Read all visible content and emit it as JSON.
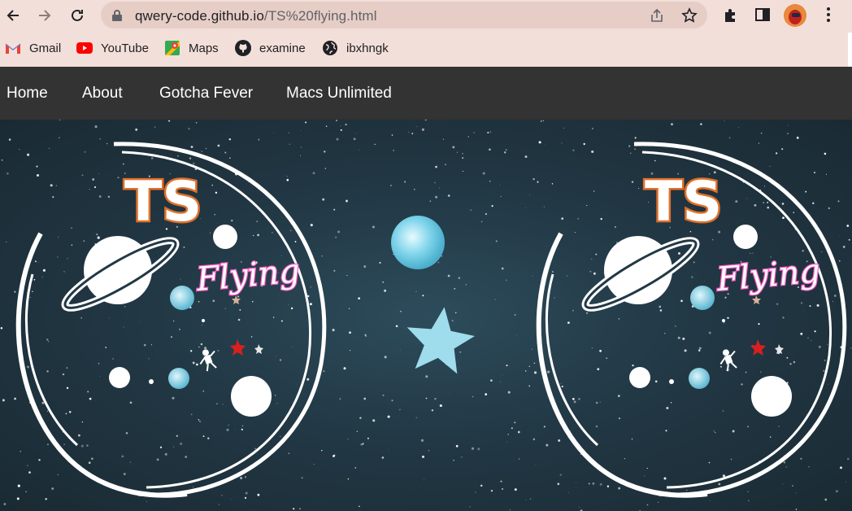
{
  "browser": {
    "url_host": "qwery-code.github.io",
    "url_path": "/TS%20flying.html"
  },
  "bookmarks": [
    {
      "label": "Gmail",
      "icon": "gmail-icon"
    },
    {
      "label": "YouTube",
      "icon": "youtube-icon"
    },
    {
      "label": "Maps",
      "icon": "maps-icon"
    },
    {
      "label": "examine",
      "icon": "github-icon"
    },
    {
      "label": "ibxhngk",
      "icon": "globe-icon"
    }
  ],
  "site_nav": {
    "home": "Home",
    "about": "About",
    "gotcha": "Gotcha Fever",
    "macs": "Macs Unlimited"
  },
  "hero": {
    "logo_title": "TS",
    "logo_subtitle": "Flying"
  },
  "colors": {
    "nav_bg": "#333333",
    "chrome_bg": "#f3dfd9",
    "logo_orange": "#e0702a",
    "logo_pink": "#ff5fc8"
  }
}
